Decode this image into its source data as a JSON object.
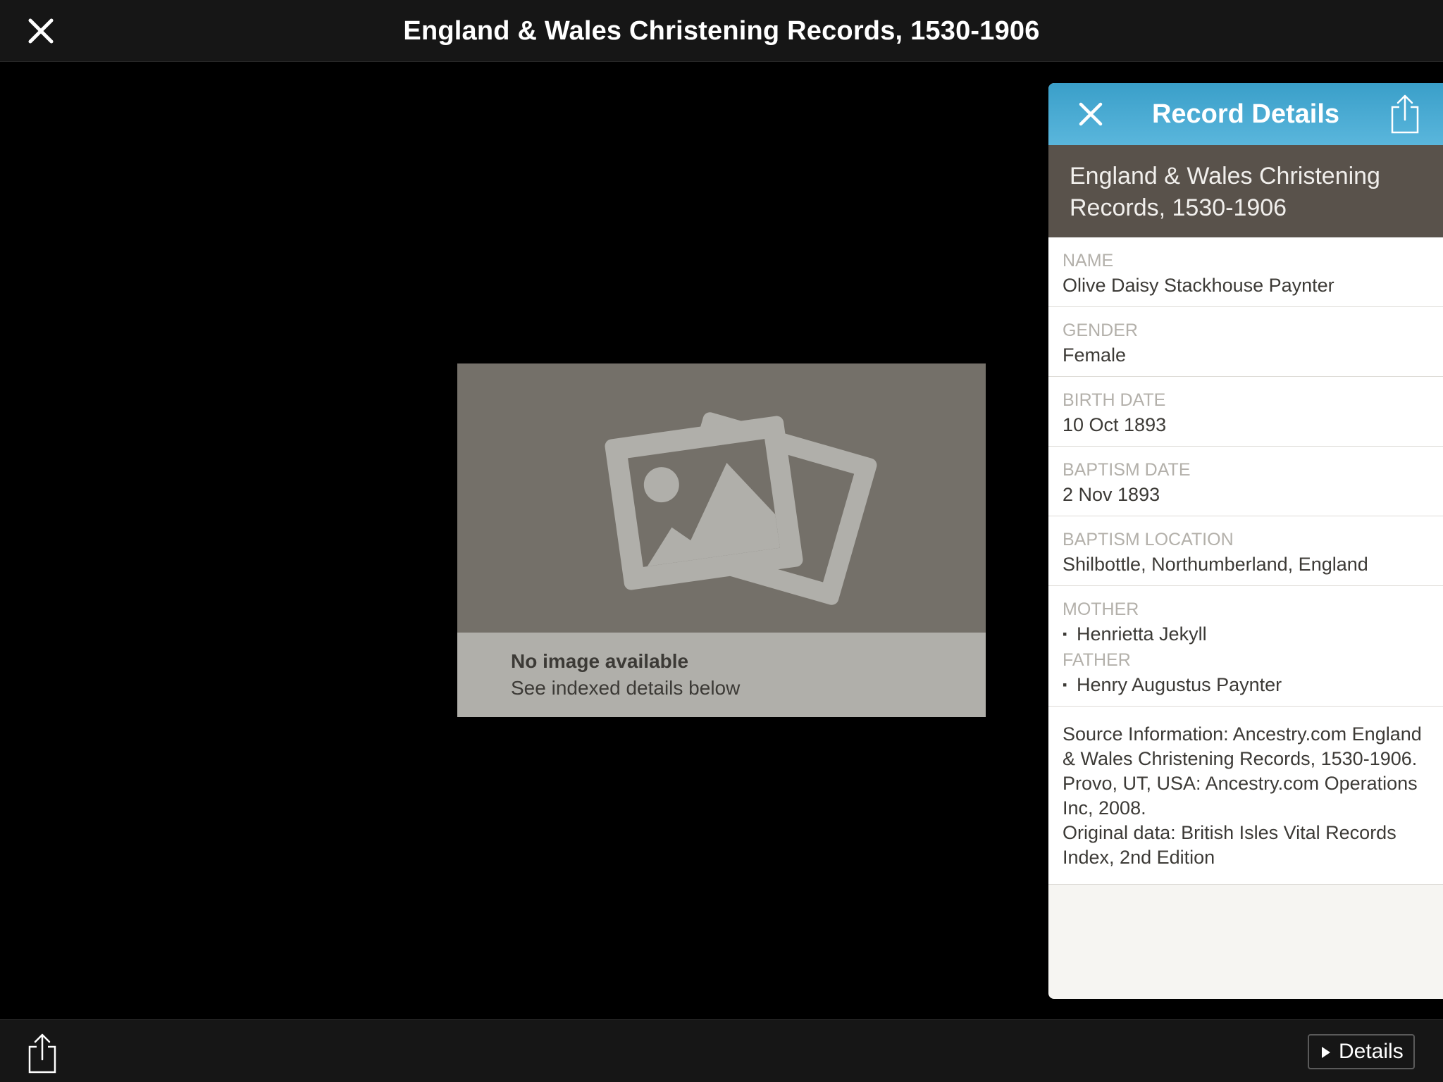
{
  "topbar": {
    "title": "England & Wales Christening Records, 1530-1906",
    "close_icon": "close-icon"
  },
  "placeholder": {
    "icon": "photo-stack-icon",
    "title": "No image available",
    "subtitle": "See indexed details below"
  },
  "panel": {
    "header_title": "Record Details",
    "close_icon": "close-icon",
    "share_icon": "share-icon",
    "collection": "England & Wales Christening Records, 1530-1906",
    "fields": {
      "name": {
        "label": "NAME",
        "value": "Olive Daisy Stackhouse Paynter"
      },
      "gender": {
        "label": "GENDER",
        "value": "Female"
      },
      "birth_date": {
        "label": "BIRTH DATE",
        "value": "10 Oct 1893"
      },
      "baptism_date": {
        "label": "BAPTISM DATE",
        "value": "2 Nov 1893"
      },
      "baptism_location": {
        "label": "BAPTISM LOCATION",
        "value": "Shilbottle, Northumberland, England"
      },
      "mother": {
        "label": "MOTHER",
        "value": "Henrietta Jekyll"
      },
      "father": {
        "label": "FATHER",
        "value": "Henry Augustus Paynter"
      }
    },
    "source_line1": "Source Information: Ancestry.com England & Wales Christening Records, 1530-1906. Provo, UT, USA: Ancestry.com Operations Inc, 2008.",
    "source_line2": "Original data: British Isles Vital Records Index, 2nd Edition"
  },
  "bottombar": {
    "share_icon": "share-icon",
    "details_label": "Details"
  },
  "colors": {
    "bar_bg": "#161616",
    "panel_header": "#4aaad3",
    "collection_bar": "#59524b",
    "placeholder_bg": "#76726b",
    "caption_bg": "#b0afaa"
  }
}
